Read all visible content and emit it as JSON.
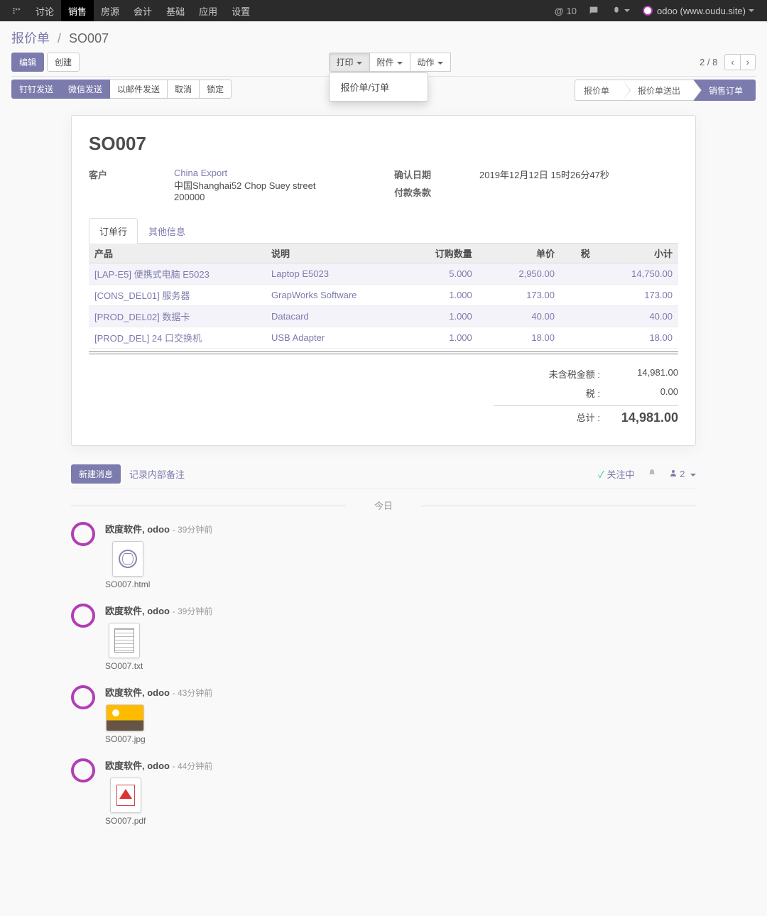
{
  "nav": {
    "items": [
      "讨论",
      "销售",
      "房源",
      "会计",
      "基础",
      "应用",
      "设置"
    ],
    "active_index": 1,
    "notif_count": "10",
    "user": "odoo (www.oudu.site)"
  },
  "breadcrumb": {
    "root": "报价单",
    "current": "SO007"
  },
  "buttons": {
    "edit": "编辑",
    "create": "创建"
  },
  "dropdowns": {
    "print": "打印",
    "attach": "附件",
    "action": "动作",
    "print_menu_item": "报价单/订单"
  },
  "pager": {
    "text": "2 / 8"
  },
  "status_buttons": [
    "钉钉发送",
    "微信发送",
    "以邮件发送",
    "取消",
    "锁定"
  ],
  "status_button_primary": [
    true,
    true,
    false,
    false,
    false
  ],
  "stages": [
    "报价单",
    "报价单送出",
    "销售订单"
  ],
  "stage_active_index": 2,
  "record": {
    "name": "SO007",
    "labels": {
      "customer": "客户",
      "confirm_date": "确认日期",
      "payment_terms": "付款条款"
    },
    "customer_name": "China Export",
    "customer_addr1": "中国Shanghai52 Chop Suey street",
    "customer_addr2": "200000",
    "confirm_date": "2019年12月12日 15时26分47秒",
    "payment_terms": ""
  },
  "tabs": [
    "订单行",
    "其他信息"
  ],
  "tab_active_index": 0,
  "line_headers": {
    "product": "产品",
    "desc": "说明",
    "qty": "订购数量",
    "price": "单价",
    "tax": "税",
    "subtotal": "小计"
  },
  "lines": [
    {
      "product": "[LAP-E5] 便携式电脑 E5023",
      "desc": "Laptop E5023",
      "qty": "5.000",
      "price": "2,950.00",
      "tax": "",
      "subtotal": "14,750.00"
    },
    {
      "product": "[CONS_DEL01] 服务器",
      "desc": "GrapWorks Software",
      "qty": "1.000",
      "price": "173.00",
      "tax": "",
      "subtotal": "173.00"
    },
    {
      "product": "[PROD_DEL02] 数据卡",
      "desc": "Datacard",
      "qty": "1.000",
      "price": "40.00",
      "tax": "",
      "subtotal": "40.00"
    },
    {
      "product": "[PROD_DEL] 24 口交换机",
      "desc": "USB Adapter",
      "qty": "1.000",
      "price": "18.00",
      "tax": "",
      "subtotal": "18.00"
    }
  ],
  "totals": {
    "untaxed_label": "未含税金额 :",
    "untaxed": "14,981.00",
    "tax_label": "税 :",
    "tax": "0.00",
    "total_label": "总计 :",
    "total": "14,981.00"
  },
  "chatter": {
    "new_msg": "新建消息",
    "log_note": "记录内部备注",
    "following": "关注中",
    "followers": "2",
    "today": "今日",
    "messages": [
      {
        "who": "欧度软件, odoo",
        "when": "- 39分钟前",
        "file": "SO007.html",
        "kind": "html"
      },
      {
        "who": "欧度软件, odoo",
        "when": "- 39分钟前",
        "file": "SO007.txt",
        "kind": "txt"
      },
      {
        "who": "欧度软件, odoo",
        "when": "- 43分钟前",
        "file": "SO007.jpg",
        "kind": "jpg"
      },
      {
        "who": "欧度软件, odoo",
        "when": "- 44分钟前",
        "file": "SO007.pdf",
        "kind": "pdf"
      }
    ]
  }
}
